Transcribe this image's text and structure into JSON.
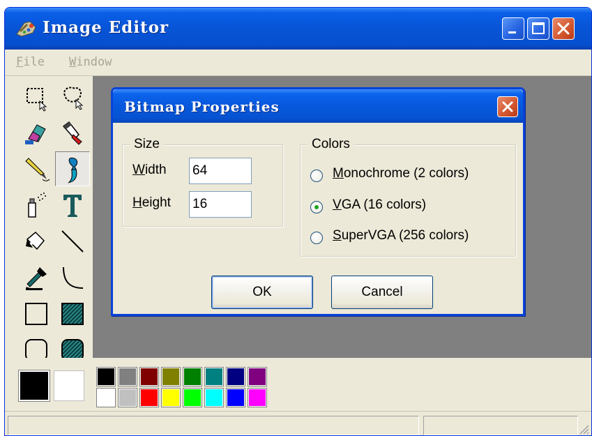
{
  "window": {
    "title": "Image Editor",
    "icon": "paint-brush-app-icon"
  },
  "menubar": {
    "items": [
      {
        "label": "File",
        "accel": "F",
        "rest": "ile"
      },
      {
        "label": "Window",
        "accel": "W",
        "rest": "indow"
      }
    ]
  },
  "toolbox": {
    "tools": [
      "rect-select-icon",
      "free-select-icon",
      "eraser-icon",
      "fill-icon",
      "pencil-icon",
      "brush-icon",
      "airbrush-icon",
      "text-icon",
      "pen-icon",
      "line-icon",
      "color-picker-icon",
      "curve-icon",
      "rectangle-icon",
      "filled-rectangle-icon",
      "rounded-rect-icon",
      "filled-rounded-rect-icon"
    ],
    "selected": "brush-icon"
  },
  "palette": {
    "foreground": "#000000",
    "background": "#ffffff",
    "colors_top": [
      "#000000",
      "#808080",
      "#800000",
      "#808000",
      "#008000",
      "#008080",
      "#000080",
      "#800080"
    ],
    "colors_bottom": [
      "#ffffff",
      "#c0c0c0",
      "#ff0000",
      "#ffff00",
      "#00ff00",
      "#00ffff",
      "#0000ff",
      "#ff00ff"
    ]
  },
  "dialog": {
    "title": "Bitmap Properties",
    "size_group": {
      "label": "Size",
      "width_label": {
        "accel": "W",
        "rest": "idth"
      },
      "height_label": {
        "accel": "H",
        "rest": "eight"
      },
      "width_value": "64",
      "height_value": "16"
    },
    "colors_group": {
      "label": "Colors",
      "options": [
        {
          "accel": "M",
          "rest": "onochrome (2 colors)",
          "selected": false
        },
        {
          "accel": "V",
          "rest": "GA (16 colors)",
          "selected": true
        },
        {
          "accel": "S",
          "rest": "uperVGA (256 colors)",
          "selected": false
        }
      ]
    },
    "ok_label": "OK",
    "cancel_label": "Cancel"
  }
}
